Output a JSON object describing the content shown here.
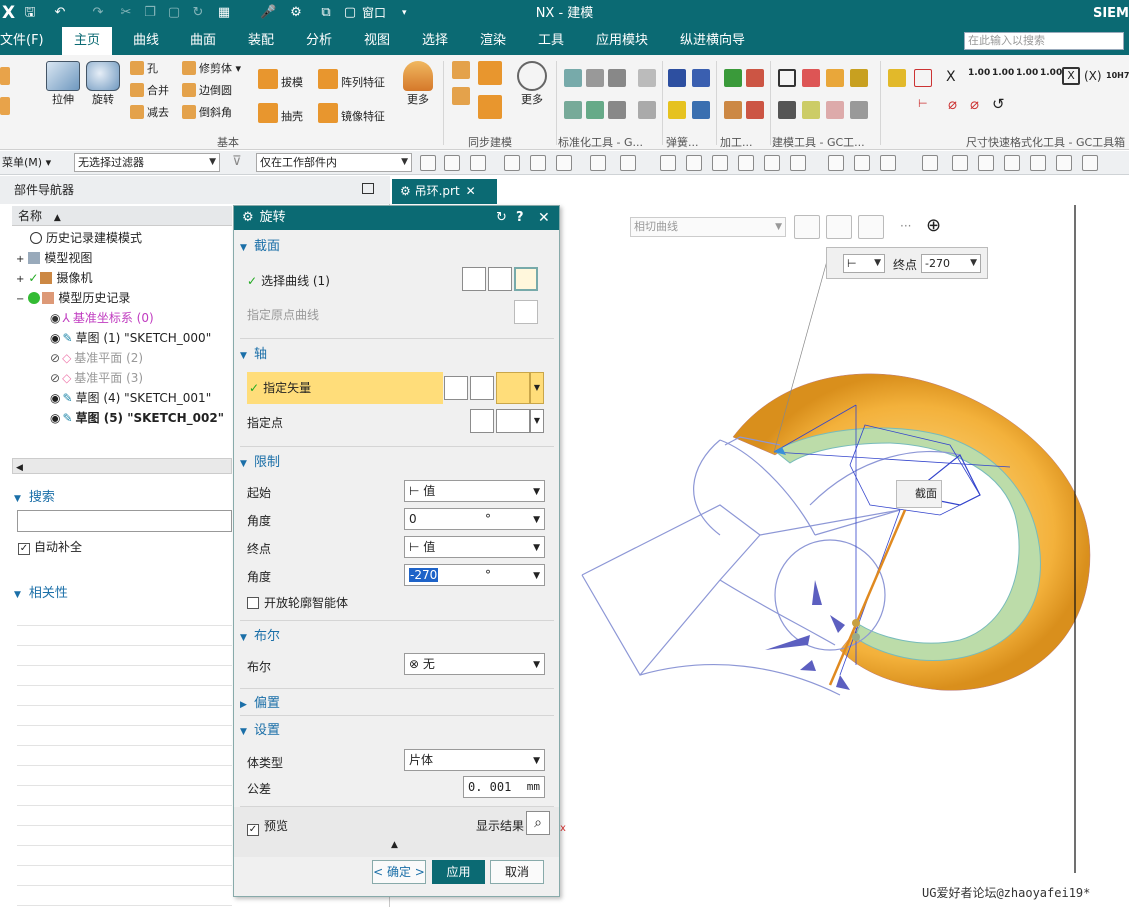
{
  "title_bar": {
    "logo": "X",
    "title": "NX - 建模",
    "brand": "SIEM",
    "window_menu": "窗口"
  },
  "menu": {
    "items": [
      "文件(F)",
      "主页",
      "曲线",
      "曲面",
      "装配",
      "分析",
      "视图",
      "选择",
      "渲染",
      "工具",
      "应用模块",
      "纵进横向导"
    ],
    "active": "主页",
    "search_placeholder": "在此输入以搜索"
  },
  "ribbon": {
    "big": {
      "extrude": "拉伸",
      "revolve": "旋转",
      "draft": "拔模",
      "shell": "抽壳",
      "more1": "更多",
      "more2": "更多"
    },
    "small": {
      "hole": "孔",
      "unite": "合并",
      "subtract": "减去",
      "trim": "修剪体",
      "edge_blend": "边倒圆",
      "chamfer": "倒斜角",
      "pattern": "阵列特征",
      "mirror": "镜像特征"
    },
    "groups": {
      "basic": "基本",
      "sync": "同步建模",
      "std": "标准化工具 - G...",
      "spring": "弹簧...",
      "machining": "加工...",
      "gc_model": "建模工具 - GC工...",
      "gc_dim": "尺寸快速格式化工具 - GC工具箱"
    },
    "dim_icons": [
      "1.00",
      "1.00",
      "1.00",
      "1.00",
      "(X)",
      "10H7"
    ]
  },
  "filterbar": {
    "menu": "菜单(M)",
    "filter": "无选择过滤器",
    "scope": "仅在工作部件内"
  },
  "navigator": {
    "title": "部件导航器",
    "col_name": "名称",
    "tree": [
      {
        "label": "历史记录建模模式",
        "style": "normal"
      },
      {
        "label": "模型视图",
        "style": "normal"
      },
      {
        "label": "摄像机",
        "style": "normal"
      },
      {
        "label": "模型历史记录",
        "style": "normal"
      },
      {
        "label": "基准坐标系 (0)",
        "style": "magenta"
      },
      {
        "label": "草图 (1) \"SKETCH_000\"",
        "style": "normal"
      },
      {
        "label": "基准平面 (2)",
        "style": "grey"
      },
      {
        "label": "基准平面 (3)",
        "style": "grey"
      },
      {
        "label": "草图 (4) \"SKETCH_001\"",
        "style": "normal"
      },
      {
        "label": "草图 (5) \"SKETCH_002\"",
        "style": "bold"
      }
    ],
    "search_section": "搜索",
    "autocomplete": "自动补全",
    "relevance_section": "相关性"
  },
  "tab": {
    "label": "吊环.prt"
  },
  "dialog": {
    "title": "旋转",
    "section": {
      "label": "截面",
      "select_curve": "选择曲线 (1)",
      "origin_curve": "指定原点曲线"
    },
    "axis": {
      "label": "轴",
      "vector": "指定矢量",
      "point": "指定点"
    },
    "limits": {
      "label": "限制",
      "start": "起始",
      "start_val": "值",
      "angle1": "角度",
      "angle1_val": "0",
      "unit1": "°",
      "end": "终点",
      "end_val": "值",
      "angle2": "角度",
      "angle2_val": "-270",
      "unit2": "°",
      "open_profile": "开放轮廓智能体"
    },
    "bool": {
      "label": "布尔",
      "row": "布尔",
      "value": "无"
    },
    "offset": {
      "label": "偏置"
    },
    "settings": {
      "label": "设置",
      "body_type": "体类型",
      "body_val": "片体",
      "tolerance": "公差",
      "tol_val": "0. 001",
      "tol_unit": "mm"
    },
    "preview": "预览",
    "show_result": "显示结果",
    "ok": "< 确定 >",
    "apply": "应用",
    "cancel": "取消"
  },
  "graphics": {
    "tangent_curve": "相切曲线",
    "endpoint_label": "终点",
    "endpoint_value": "-270",
    "section_label": "截面",
    "watermark": "UG爱好者论坛@zhaoyafei19*"
  },
  "colors": {
    "teal": "#0b6a73",
    "torus": "#f5b43a",
    "band": "#b8d9a8",
    "blue": "#1b6fa8"
  }
}
